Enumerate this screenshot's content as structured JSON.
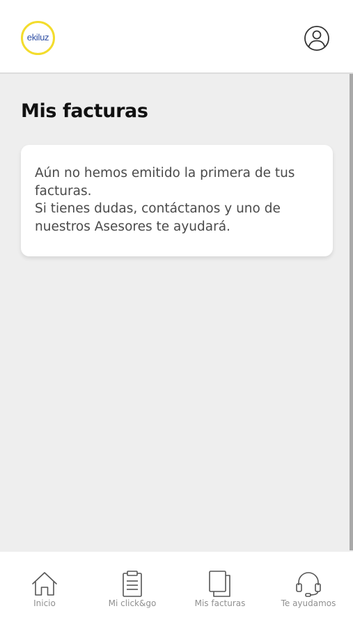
{
  "header": {
    "logo_text": "ekiluz",
    "profile_icon": "user-circle-icon"
  },
  "main": {
    "title": "Mis facturas",
    "message_line1": "Aún no hemos emitido la primera de tus facturas.",
    "message_line2": "Si tienes dudas, contáctanos y uno de nuestros Asesores te ayudará."
  },
  "bottom_nav": {
    "items": [
      {
        "label": "Inicio",
        "icon": "home-icon"
      },
      {
        "label": "Mi click&go",
        "icon": "clipboard-icon"
      },
      {
        "label": "Mis facturas",
        "icon": "documents-icon"
      },
      {
        "label": "Te ayudamos",
        "icon": "headset-icon"
      }
    ]
  },
  "colors": {
    "logo_ring": "#f3dc2c",
    "logo_text": "#2f4fa4",
    "background": "#eeeeee",
    "card": "#ffffff",
    "nav_label": "#909090"
  }
}
